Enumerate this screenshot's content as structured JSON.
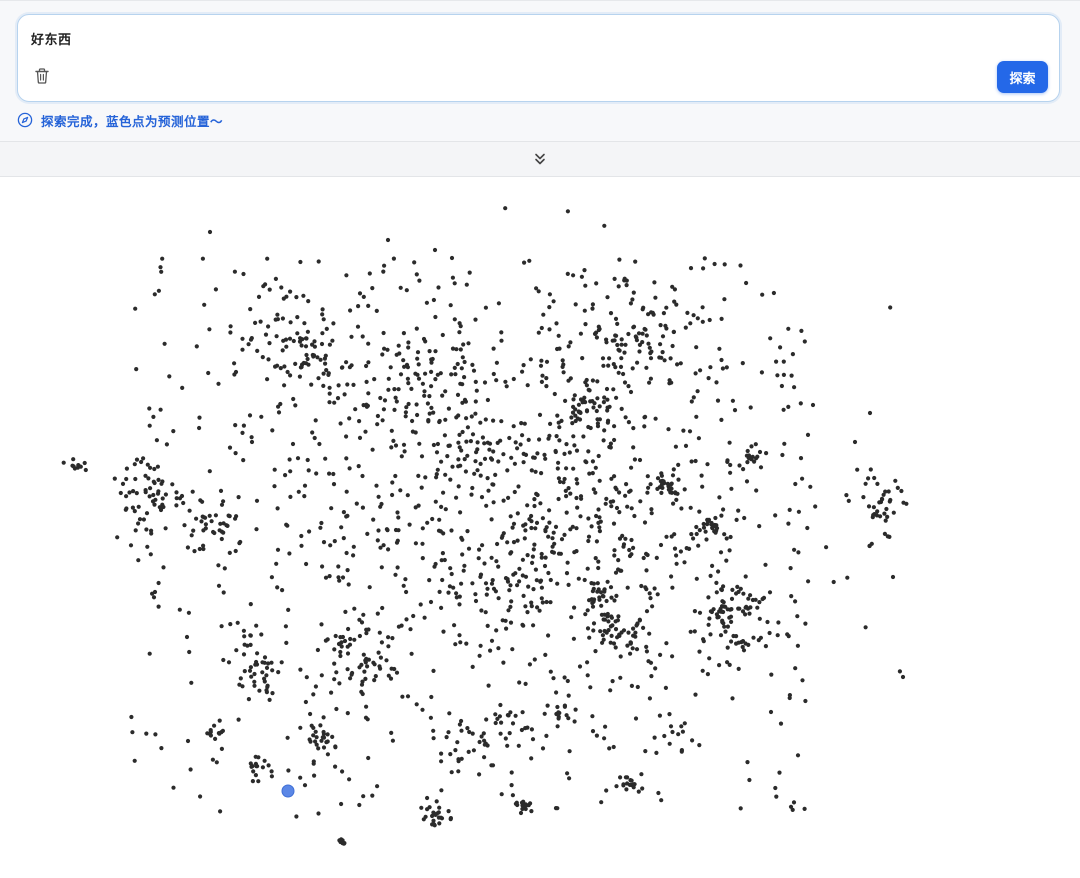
{
  "search": {
    "query": "好东西",
    "button_label": "探索"
  },
  "status": {
    "text": "探索完成，蓝色点为预测位置～",
    "color": "#2563d8"
  },
  "icons": {
    "clear": "trash-icon",
    "status": "compass-icon",
    "collapse": "chevrons-down-icon"
  },
  "colors": {
    "accent": "#2468e8",
    "point": "#2b2b2b",
    "predicted_point": "#5b87e6"
  },
  "scatter": {
    "point_count_approx": 2000,
    "predicted_point_shown": true
  }
}
